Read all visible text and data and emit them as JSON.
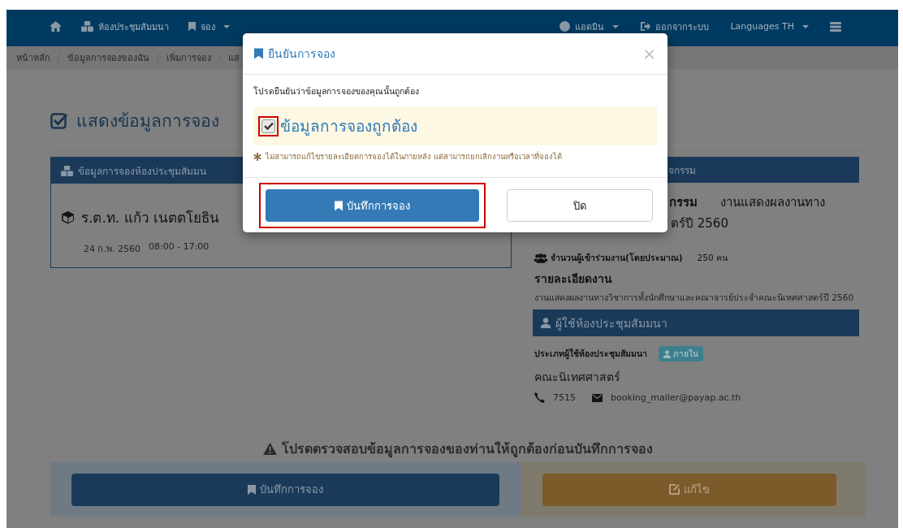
{
  "navbar": {
    "left": [
      {
        "label": "ห้องประชุมสัมมนา",
        "dropdown": false
      },
      {
        "label": "จอง",
        "dropdown": true
      }
    ],
    "right": [
      {
        "label": "แอดมิน",
        "dropdown": true
      },
      {
        "label": "ออกจากระบบ",
        "dropdown": false
      },
      {
        "label": "Languages TH",
        "dropdown": true
      }
    ]
  },
  "breadcrumb": [
    "หน้าหลัก",
    "ข้อมูลการจองของฉัน",
    "เพิ่มการจอง",
    "แส"
  ],
  "heading": "แสดงข้อมูลการจอง",
  "booking_panel": {
    "title": "ข้อมูลการจองห้องประชุมสัมมน",
    "room": "ร.ต.ท. แก้ว เนตตโยธิน",
    "date": "24 ก.พ. 2560",
    "time": "08:00 - 17:00"
  },
  "activity_panel": {
    "header": "จกรรม",
    "title_label": "กรรม",
    "title_value": "งานแสดงผลงานทาง",
    "title_rest": "ตร์ปี 2560",
    "participants_label": "จำนวนผู้เข้าร่วมงาน(โดยประมาณ)",
    "participants_value": "250 คน",
    "details_heading": "รายละเอียดงาน",
    "details_text": "งานแสดงผลงานทางวิชาการทั้งนักศึกษาและคณาจารย์ประจำคณะนิเทศศาสตร์ปี 2560",
    "user_header": "ผู้ใช้ห้องประชุมสัมมนา",
    "user_type_label": "ประเภทผู้ใช้ห้องประชุมสัมมนา",
    "user_type_badge": "ภายใน",
    "department": "คณะนิเทศศาสตร์",
    "phone": "7515",
    "email": "booking_mailer@payap.ac.th"
  },
  "warning": "โปรดตรวจสอบข้อมูลการจองของท่านให้ถูกต้องก่อนบันทึกการจอง",
  "actions": [
    {
      "label": "บันทึกการจอง",
      "kind": "primary"
    },
    {
      "label": "แก้ไข",
      "kind": "warning"
    }
  ],
  "modal": {
    "title": "ยืนยันการจอง",
    "close": "×",
    "message": "โปรดยืนยันว่าข้อมูลการจองของคุณนั้นถูกต้อง",
    "confirm": {
      "label": "ข้อมูลการจองถูกต้อง",
      "checked": true
    },
    "note": "ไม่สามารถแก้ไขรายละเอียดการจองได้ในภายหลัง แต่สามารถยกเลิกงานหรือเวลาที่จองได้",
    "buttons": [
      {
        "label": "บันทึกการจอง",
        "kind": "primary",
        "highlighted": true
      },
      {
        "label": "ปิด",
        "kind": "default",
        "highlighted": false
      }
    ]
  }
}
